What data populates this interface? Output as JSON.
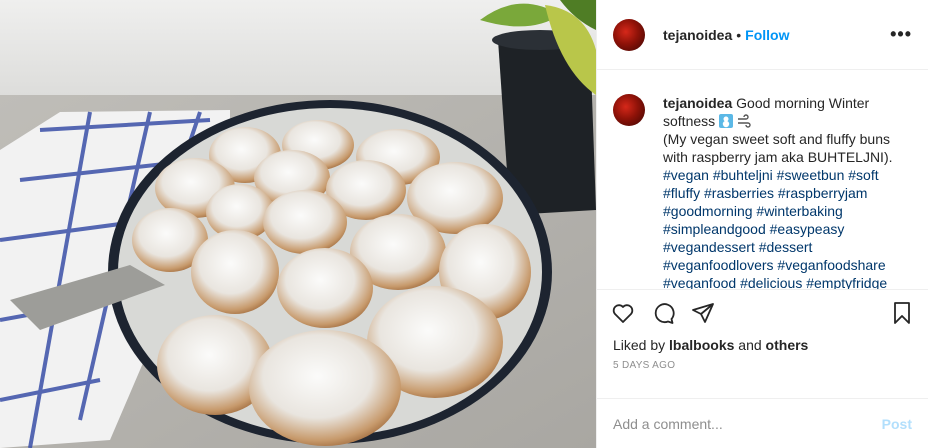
{
  "post": {
    "username": "tejanoidea",
    "follow_label": "Follow",
    "separator": "•",
    "more_label": "•••"
  },
  "caption": {
    "username": "tejanoidea",
    "line1": "Good morning Winter softness",
    "emoji_icons": [
      "snowman-icon",
      "wind-icon"
    ],
    "body": "(My vegan sweet soft and fluffy buns with raspberry jam aka BUHTELJNI).",
    "hashtags": [
      "#vegan",
      "#buhteljni",
      "#sweetbun",
      "#soft",
      "#fluffy",
      "#rasberries",
      "#raspberryjam",
      "#goodmorning",
      "#winterbaking",
      "#simpleandgood",
      "#easypeasy",
      "#vegandessert",
      "#dessert",
      "#veganfoodlovers",
      "#veganfoodshare",
      "#veganfood",
      "#delicious",
      "#emptyfridge"
    ]
  },
  "likes": {
    "prefix": "Liked by",
    "user": "lbalbooks",
    "conj": "and",
    "others": "others"
  },
  "timestamp": "5 DAYS AGO",
  "comment_box": {
    "placeholder": "Add a comment...",
    "post_label": "Post"
  },
  "colors": {
    "link_blue": "#0095f6",
    "hashtag": "#00376b",
    "muted": "#8e8e8e",
    "post_disabled": "#b2dffc"
  }
}
